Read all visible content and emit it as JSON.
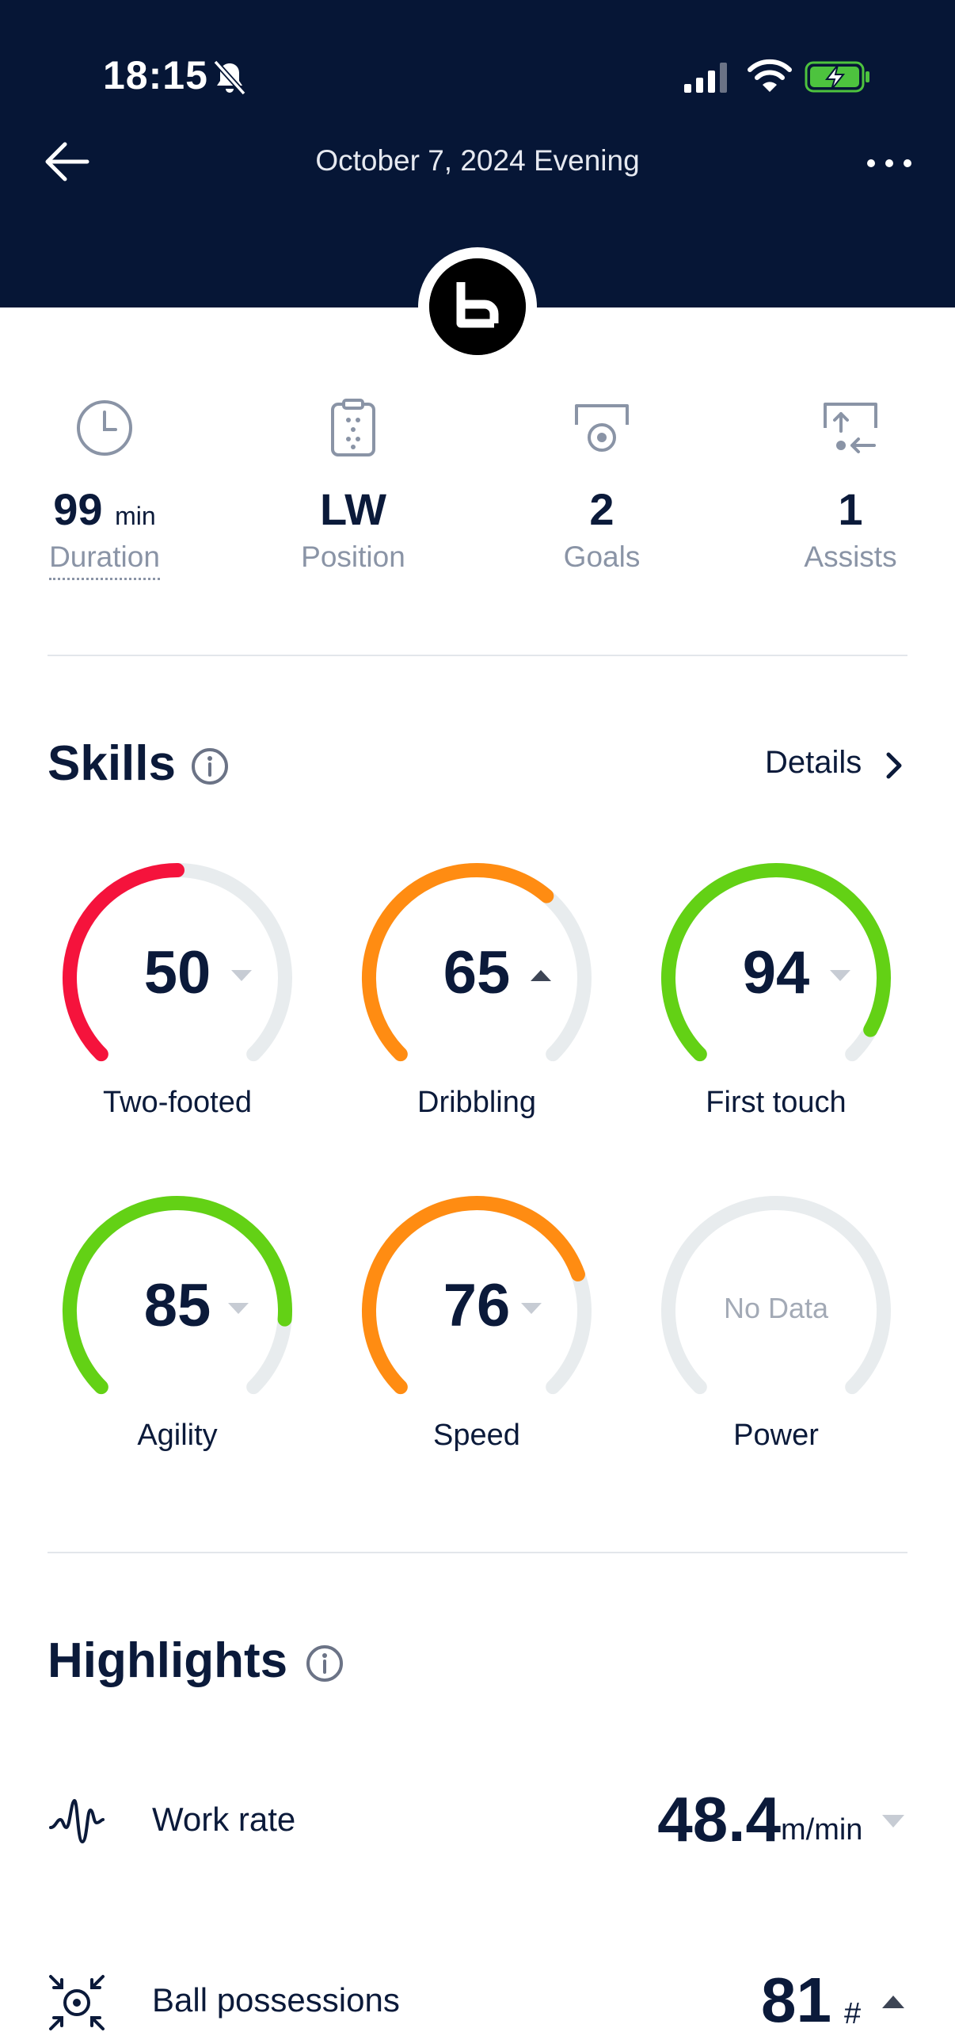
{
  "status_bar": {
    "time": "18:15"
  },
  "header": {
    "title": "October 7, 2024 Evening"
  },
  "stats": [
    {
      "value": "99",
      "unit": "min",
      "label": "Duration",
      "icon": "clock-icon"
    },
    {
      "value": "LW",
      "unit": "",
      "label": "Position",
      "icon": "clipboard-icon"
    },
    {
      "value": "2",
      "unit": "",
      "label": "Goals",
      "icon": "goal-icon"
    },
    {
      "value": "1",
      "unit": "",
      "label": "Assists",
      "icon": "assist-icon"
    }
  ],
  "skills": {
    "title": "Skills",
    "details_label": "Details",
    "items": [
      {
        "label": "Two-footed",
        "value": 50,
        "display": "50",
        "color": "#f5133c",
        "trend": "down"
      },
      {
        "label": "Dribbling",
        "value": 65,
        "display": "65",
        "color": "#ff8c12",
        "trend": "up"
      },
      {
        "label": "First touch",
        "value": 94,
        "display": "94",
        "color": "#63d115",
        "trend": "down"
      },
      {
        "label": "Agility",
        "value": 85,
        "display": "85",
        "color": "#63d115",
        "trend": "down"
      },
      {
        "label": "Speed",
        "value": 76,
        "display": "76",
        "color": "#ff8c12",
        "trend": "down"
      },
      {
        "label": "Power",
        "value": null,
        "display": "No Data",
        "color": "#e3e8ea",
        "trend": "none"
      }
    ],
    "track_color": "#e8ecee"
  },
  "highlights": {
    "title": "Highlights",
    "items": [
      {
        "label": "Work rate",
        "value": "48.4",
        "unit": "m/min",
        "trend": "down",
        "icon": "work-rate-icon"
      },
      {
        "label": "Ball possessions",
        "value": "81",
        "unit": "#",
        "trend": "up",
        "icon": "ball-possessions-icon"
      }
    ]
  }
}
